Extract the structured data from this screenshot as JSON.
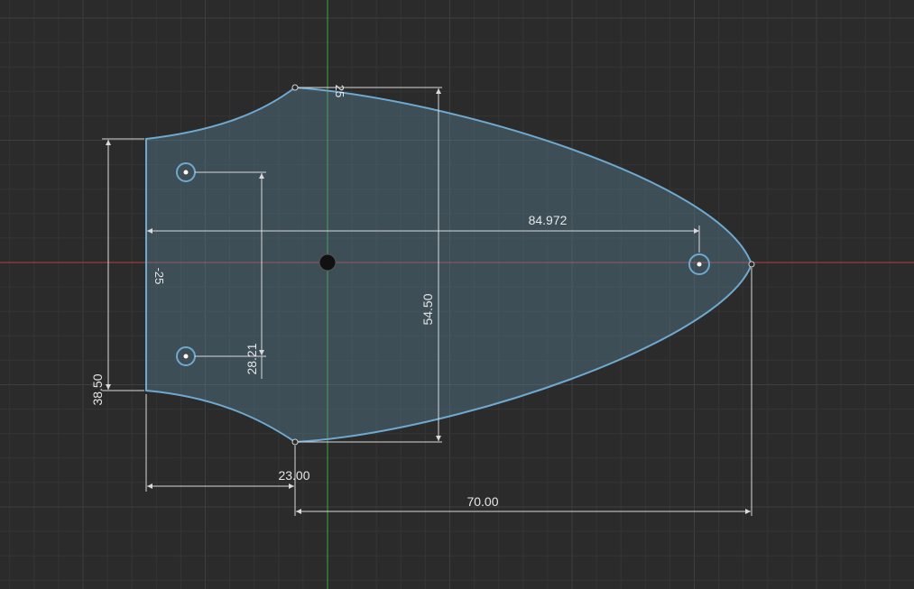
{
  "sketch": {
    "colors": {
      "background": "#2b2b2b",
      "grid_minor": "#353535",
      "grid_major": "#3e3e3e",
      "x_axis": "#b04040",
      "y_axis": "#3fa83f",
      "profile_stroke": "#6fa9cf",
      "profile_fill": "#5f8ea5",
      "dimension": "#d9d9d9"
    },
    "dimensions": {
      "width_overall": "84.972",
      "height_main": "54.50",
      "height_left": "38.50",
      "hole_spacing": "28.21",
      "offset_left": "23.00",
      "length_right": "70.00",
      "radius_top": "25",
      "radius_left": "-25"
    }
  }
}
